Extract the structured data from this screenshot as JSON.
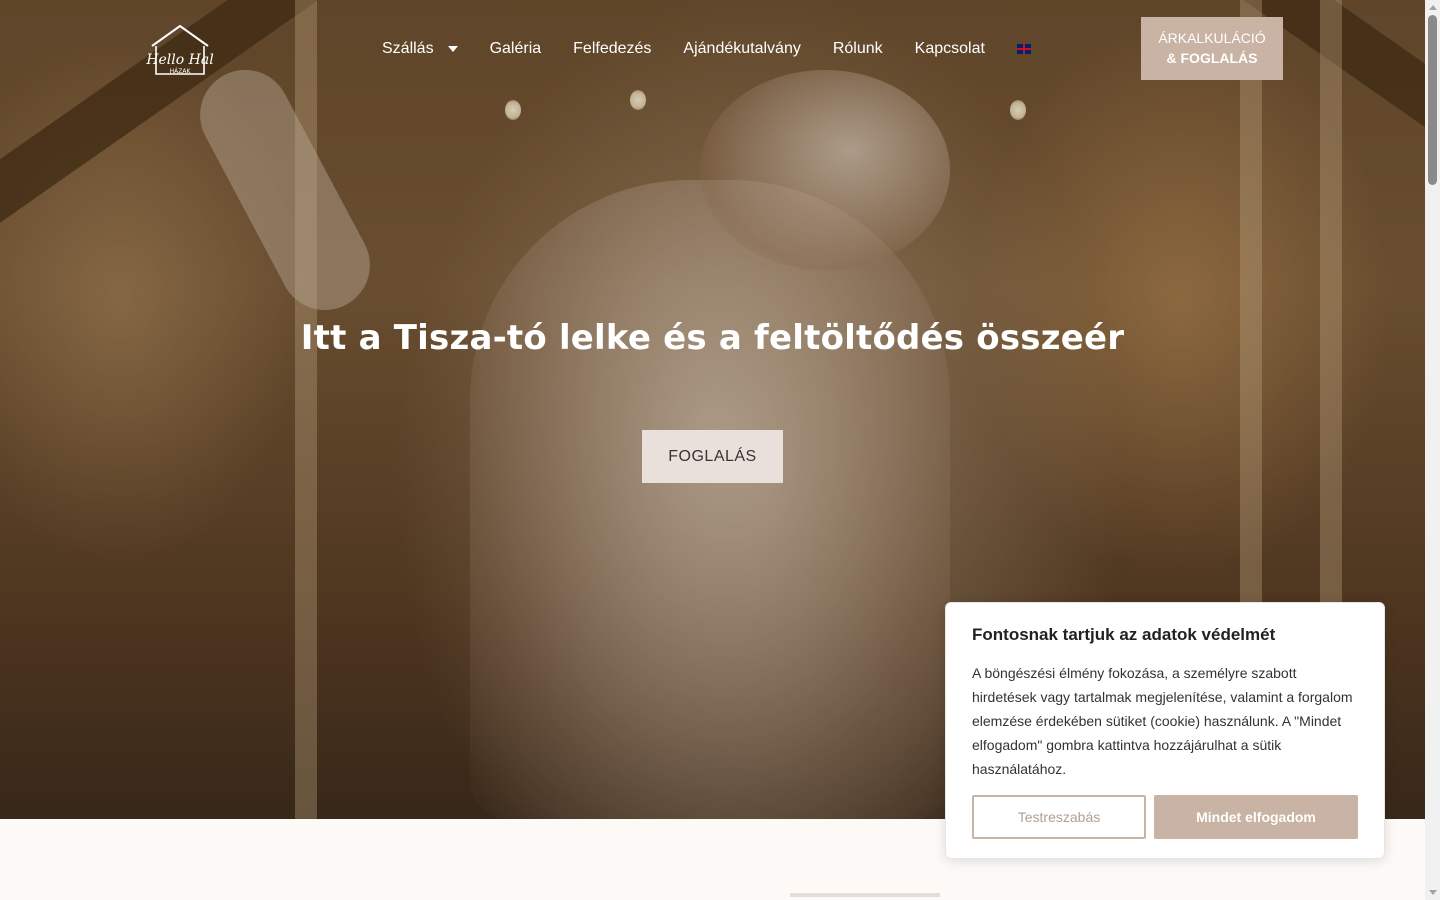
{
  "brand": {
    "logo_text": "Hello Hal",
    "logo_subtext": "HÁZAK"
  },
  "nav": {
    "items": [
      {
        "label": "Szállás",
        "has_dropdown": true
      },
      {
        "label": "Galéria"
      },
      {
        "label": "Felfedezés"
      },
      {
        "label": "Ajándékutalvány"
      },
      {
        "label": "Rólunk"
      },
      {
        "label": "Kapcsolat"
      }
    ],
    "language_flag": "uk-flag-icon",
    "cta": {
      "line1": "ÁRKALKULÁCIÓ",
      "line2": "& FOGLALÁS"
    }
  },
  "hero": {
    "headline": "Itt a Tisza-tó lelke és a feltöltődés összeér",
    "button_label": "FOGLALÁS"
  },
  "cookie_banner": {
    "title": "Fontosnak tartjuk az adatok védelmét",
    "text": "A böngészési élmény fokozása, a személyre szabott hirdetések vagy tartalmak megjelenítése, valamint a forgalom elemzése érdekében sütiket (cookie) használunk. A \"Mindet elfogadom\" gombra kattintva hozzájárulhat a sütik használatához.",
    "customize_label": "Testreszabás",
    "accept_label": "Mindet elfogadom"
  },
  "colors": {
    "accent": "#c9b3a4",
    "hero_button_bg": "#e9e0dc",
    "page_bg": "#fdf9f6"
  }
}
